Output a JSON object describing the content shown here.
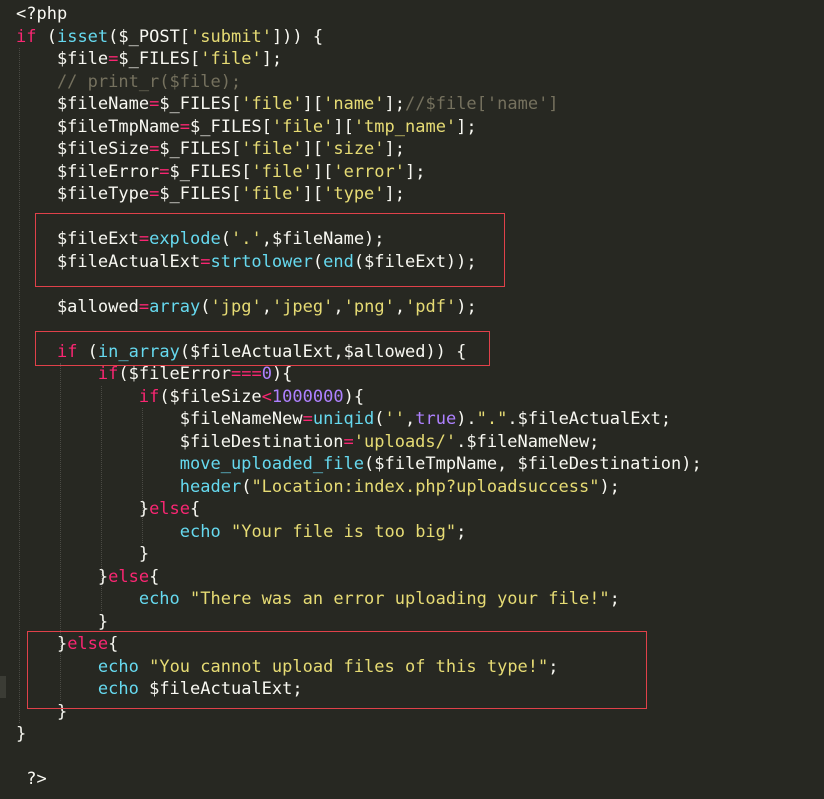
{
  "colors": {
    "background": "#272822",
    "default": "#f8f8f2",
    "keyword": "#f92672",
    "function": "#66d9ef",
    "string": "#e6db74",
    "number": "#ae81ff",
    "comment": "#75715e",
    "highlight_box": "#e0414a"
  },
  "code": {
    "lines": [
      [
        [
          "<?php",
          "default"
        ]
      ],
      [
        [
          "if",
          "keyword"
        ],
        [
          " (",
          "default"
        ],
        [
          "isset",
          "function"
        ],
        [
          "($_POST[",
          "default"
        ],
        [
          "'submit'",
          "string"
        ],
        [
          "])) {",
          "default"
        ]
      ],
      [
        [
          "    $file",
          "default"
        ],
        [
          "=",
          "keyword"
        ],
        [
          "$_FILES[",
          "default"
        ],
        [
          "'file'",
          "string"
        ],
        [
          "];",
          "default"
        ]
      ],
      [
        [
          "    // print_r($file);",
          "comment"
        ]
      ],
      [
        [
          "    $fileName",
          "default"
        ],
        [
          "=",
          "keyword"
        ],
        [
          "$_FILES[",
          "default"
        ],
        [
          "'file'",
          "string"
        ],
        [
          "][",
          "default"
        ],
        [
          "'name'",
          "string"
        ],
        [
          "];",
          "default"
        ],
        [
          "//$file['name']",
          "comment"
        ]
      ],
      [
        [
          "    $fileTmpName",
          "default"
        ],
        [
          "=",
          "keyword"
        ],
        [
          "$_FILES[",
          "default"
        ],
        [
          "'file'",
          "string"
        ],
        [
          "][",
          "default"
        ],
        [
          "'tmp_name'",
          "string"
        ],
        [
          "];",
          "default"
        ]
      ],
      [
        [
          "    $fileSize",
          "default"
        ],
        [
          "=",
          "keyword"
        ],
        [
          "$_FILES[",
          "default"
        ],
        [
          "'file'",
          "string"
        ],
        [
          "][",
          "default"
        ],
        [
          "'size'",
          "string"
        ],
        [
          "];",
          "default"
        ]
      ],
      [
        [
          "    $fileError",
          "default"
        ],
        [
          "=",
          "keyword"
        ],
        [
          "$_FILES[",
          "default"
        ],
        [
          "'file'",
          "string"
        ],
        [
          "][",
          "default"
        ],
        [
          "'error'",
          "string"
        ],
        [
          "];",
          "default"
        ]
      ],
      [
        [
          "    $fileType",
          "default"
        ],
        [
          "=",
          "keyword"
        ],
        [
          "$_FILES[",
          "default"
        ],
        [
          "'file'",
          "string"
        ],
        [
          "][",
          "default"
        ],
        [
          "'type'",
          "string"
        ],
        [
          "];",
          "default"
        ]
      ],
      [],
      [
        [
          "    $fileExt",
          "default"
        ],
        [
          "=",
          "keyword"
        ],
        [
          "explode",
          "function"
        ],
        [
          "(",
          "default"
        ],
        [
          "'.'",
          "string"
        ],
        [
          ",$fileName);",
          "default"
        ]
      ],
      [
        [
          "    $fileActualExt",
          "default"
        ],
        [
          "=",
          "keyword"
        ],
        [
          "strtolower",
          "function"
        ],
        [
          "(",
          "default"
        ],
        [
          "end",
          "function"
        ],
        [
          "($fileExt));",
          "default"
        ]
      ],
      [],
      [
        [
          "    $allowed",
          "default"
        ],
        [
          "=",
          "keyword"
        ],
        [
          "array",
          "function"
        ],
        [
          "(",
          "default"
        ],
        [
          "'jpg'",
          "string"
        ],
        [
          ",",
          "default"
        ],
        [
          "'jpeg'",
          "string"
        ],
        [
          ",",
          "default"
        ],
        [
          "'png'",
          "string"
        ],
        [
          ",",
          "default"
        ],
        [
          "'pdf'",
          "string"
        ],
        [
          ");",
          "default"
        ]
      ],
      [],
      [
        [
          "    ",
          "default"
        ],
        [
          "if",
          "keyword"
        ],
        [
          " (",
          "default"
        ],
        [
          "in_array",
          "function"
        ],
        [
          "($fileActualExt,$allowed)) {",
          "default"
        ]
      ],
      [
        [
          "        ",
          "default"
        ],
        [
          "if",
          "keyword"
        ],
        [
          "($fileError",
          "default"
        ],
        [
          "===",
          "keyword"
        ],
        [
          "0",
          "number"
        ],
        [
          "){",
          "default"
        ]
      ],
      [
        [
          "            ",
          "default"
        ],
        [
          "if",
          "keyword"
        ],
        [
          "($fileSize",
          "default"
        ],
        [
          "<",
          "keyword"
        ],
        [
          "1000000",
          "number"
        ],
        [
          "){",
          "default"
        ]
      ],
      [
        [
          "                $fileNameNew",
          "default"
        ],
        [
          "=",
          "keyword"
        ],
        [
          "uniqid",
          "function"
        ],
        [
          "(",
          "default"
        ],
        [
          "''",
          "string"
        ],
        [
          ",",
          "default"
        ],
        [
          "true",
          "number"
        ],
        [
          ").",
          "default"
        ],
        [
          "\".\"",
          "string"
        ],
        [
          ".$fileActualExt;",
          "default"
        ]
      ],
      [
        [
          "                $fileDestination",
          "default"
        ],
        [
          "=",
          "keyword"
        ],
        [
          "'uploads/'",
          "string"
        ],
        [
          ".$fileNameNew;",
          "default"
        ]
      ],
      [
        [
          "                ",
          "default"
        ],
        [
          "move_uploaded_file",
          "function"
        ],
        [
          "($fileTmpName, $fileDestination);",
          "default"
        ]
      ],
      [
        [
          "                ",
          "default"
        ],
        [
          "header",
          "function"
        ],
        [
          "(",
          "default"
        ],
        [
          "\"Location:index.php?uploadsuccess\"",
          "string"
        ],
        [
          ");",
          "default"
        ]
      ],
      [
        [
          "            }",
          "default"
        ],
        [
          "else",
          "keyword"
        ],
        [
          "{",
          "default"
        ]
      ],
      [
        [
          "                ",
          "default"
        ],
        [
          "echo",
          "function"
        ],
        [
          " ",
          "default"
        ],
        [
          "\"Your file is too big\"",
          "string"
        ],
        [
          ";",
          "default"
        ]
      ],
      [
        [
          "            }",
          "default"
        ]
      ],
      [
        [
          "        }",
          "default"
        ],
        [
          "else",
          "keyword"
        ],
        [
          "{",
          "default"
        ]
      ],
      [
        [
          "            ",
          "default"
        ],
        [
          "echo",
          "function"
        ],
        [
          " ",
          "default"
        ],
        [
          "\"There was an error uploading your file!\"",
          "string"
        ],
        [
          ";",
          "default"
        ]
      ],
      [
        [
          "        }",
          "default"
        ]
      ],
      [
        [
          "    }",
          "default"
        ],
        [
          "else",
          "keyword"
        ],
        [
          "{",
          "default"
        ]
      ],
      [
        [
          "        ",
          "default"
        ],
        [
          "echo",
          "function"
        ],
        [
          " ",
          "default"
        ],
        [
          "\"You cannot upload files of this type!\"",
          "string"
        ],
        [
          ";",
          "default"
        ]
      ],
      [
        [
          "        ",
          "default"
        ],
        [
          "echo",
          "function"
        ],
        [
          " $fileActualExt;",
          "default"
        ]
      ],
      [
        [
          "    }",
          "default"
        ]
      ],
      [
        [
          "}",
          "default"
        ]
      ],
      [],
      [
        [
          " ?>",
          "default"
        ]
      ]
    ]
  }
}
